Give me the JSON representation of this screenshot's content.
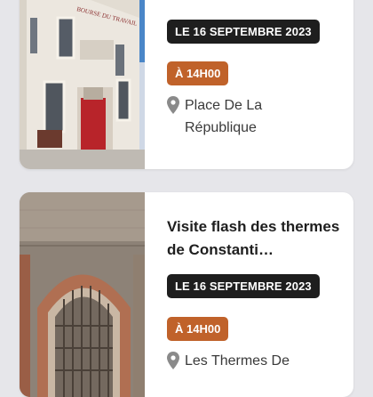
{
  "events": [
    {
      "date": "LE 16 SEPTEMBRE 2023",
      "time": "À 14H00",
      "location": "Place De La République",
      "image_sign": "BOURSE DU TRAVAIL"
    },
    {
      "title": "Visite flash des thermes de Constanti…",
      "date": "LE 16 SEPTEMBRE 2023",
      "time": "À 14H00",
      "location": "Les Thermes De"
    }
  ],
  "colors": {
    "date_badge": "#1e1e1e",
    "time_badge": "#c0622a",
    "background": "#e6e6ea"
  },
  "icons": [
    "location-pin-icon"
  ]
}
